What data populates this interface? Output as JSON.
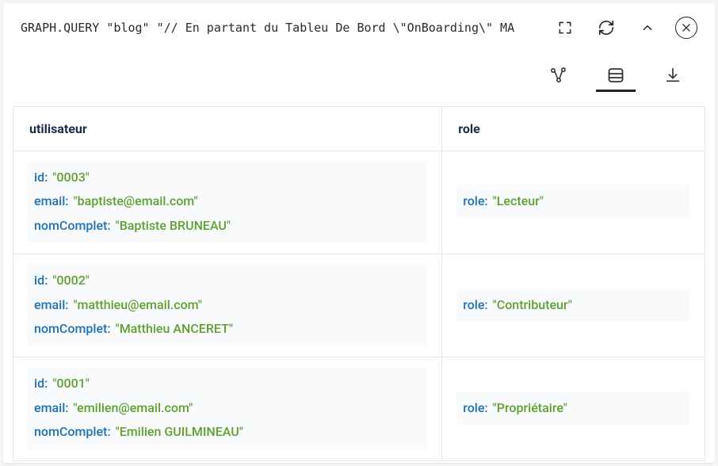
{
  "topbar": {
    "query": "GRAPH.QUERY \"blog\" \"// En partant du Tableu De Bord \\\"OnBoarding\\\" MA"
  },
  "columns": [
    "utilisateur",
    "role"
  ],
  "rows": [
    {
      "utilisateur": {
        "id": "\"0003\"",
        "email": "\"baptiste@email.com\"",
        "nomComplet": "\"Baptiste BRUNEAU\""
      },
      "role": {
        "role": "\"Lecteur\""
      }
    },
    {
      "utilisateur": {
        "id": "\"0002\"",
        "email": "\"matthieu@email.com\"",
        "nomComplet": "\"Matthieu ANCERET\""
      },
      "role": {
        "role": "\"Contributeur\""
      }
    },
    {
      "utilisateur": {
        "id": "\"0001\"",
        "email": "\"emilien@email.com\"",
        "nomComplet": "\"Emilien GUILMINEAU\""
      },
      "role": {
        "role": "\"Propriétaire\""
      }
    }
  ],
  "keys": {
    "id": "id:",
    "email": "email:",
    "nomComplet": "nomComplet:",
    "role": "role:"
  }
}
